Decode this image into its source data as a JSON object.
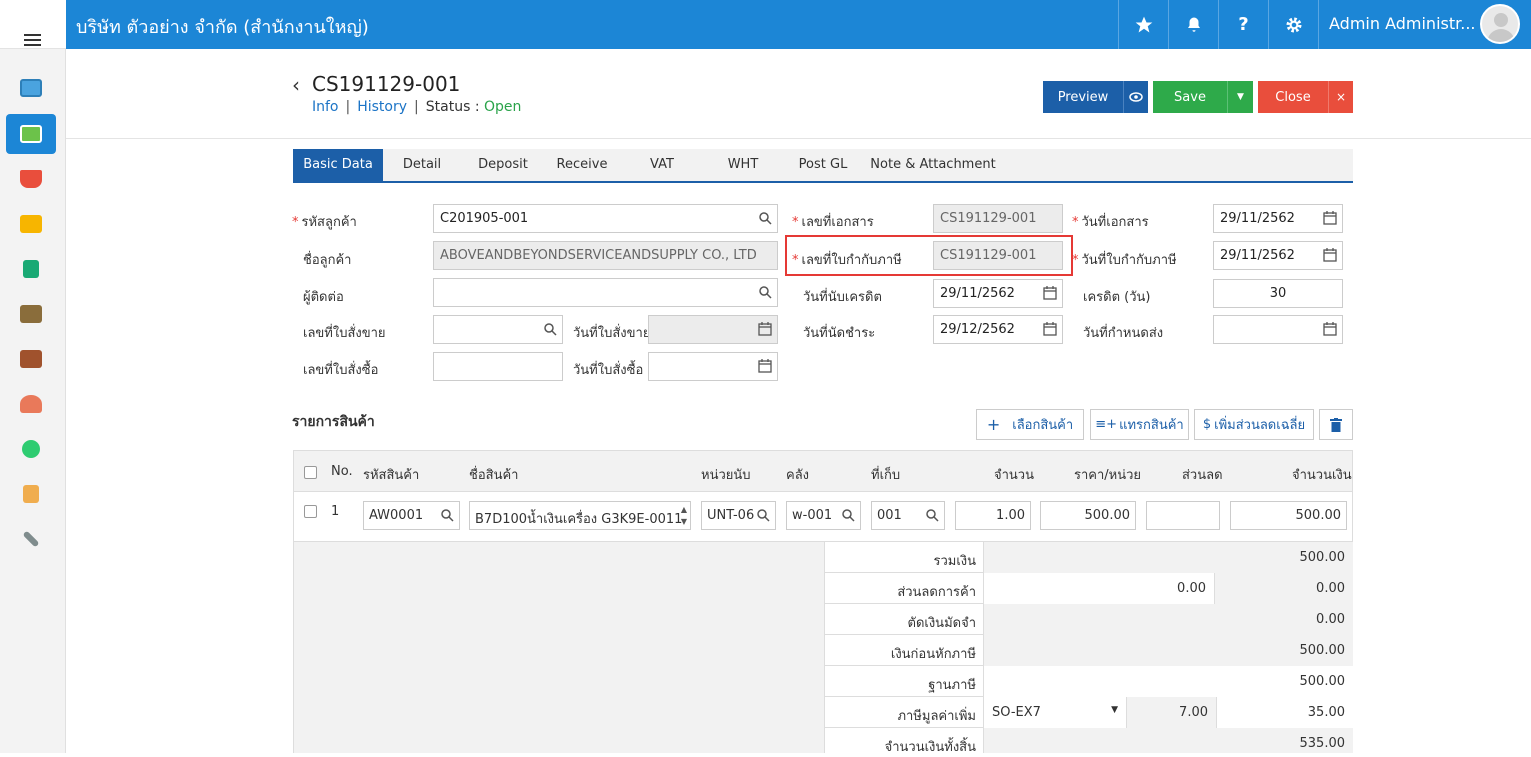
{
  "company": "บริษัท ตัวอย่าง จำกัด (สำนักงานใหญ่)",
  "user": "Admin Administr...",
  "topbar_icons": [
    "star-icon",
    "bell-icon",
    "help-icon",
    "gear-icon"
  ],
  "help_glyph": "?",
  "doc": {
    "number": "CS191129-001",
    "links": [
      "Info",
      "History"
    ],
    "status_label": "Status",
    "status_sep": ":",
    "status_value": "Open"
  },
  "actions": {
    "preview": "Preview",
    "save": "Save",
    "close": "Close"
  },
  "tabs": [
    "Basic Data",
    "Detail",
    "Deposit",
    "Receive",
    "VAT",
    "WHT",
    "Post GL",
    "Note & Attachment"
  ],
  "form": {
    "customer_code_label": "รหัสลูกค้า",
    "customer_code": "C201905-001",
    "customer_name_label": "ชื่อลูกค้า",
    "customer_name": "ABOVEANDBEYONDSERVICEANDSUPPLY CO., LTD",
    "contact_label": "ผู้ติดต่อ",
    "contact": "",
    "so_no_label": "เลขที่ใบสั่งขาย",
    "so_no": "",
    "so_date_label": "วันที่ใบสั่งขาย",
    "so_date": "",
    "po_no_label": "เลขที่ใบสั่งซื้อ",
    "po_no": "",
    "po_date_label": "วันที่ใบสั่งซื้อ",
    "po_date": "",
    "doc_no_label": "เลขที่เอกสาร",
    "doc_no": "CS191129-001",
    "tax_inv_no_label": "เลขที่ใบกำกับภาษี",
    "tax_inv_no": "CS191129-001",
    "credit_start_label": "วันที่นับเครดิต",
    "credit_start": "29/11/2562",
    "due_date_label": "วันที่นัดชำระ",
    "due_date": "29/12/2562",
    "doc_date_label": "วันที่เอกสาร",
    "doc_date": "29/11/2562",
    "tax_inv_date_label": "วันที่ใบกำกับภาษี",
    "tax_inv_date": "29/11/2562",
    "credit_days_label": "เครดิต (วัน)",
    "credit_days": "30",
    "delivery_date_label": "วันที่กำหนดส่ง",
    "delivery_date": ""
  },
  "items": {
    "title": "รายการสินค้า",
    "buttons": {
      "select": "เลือกสินค้า",
      "insert": "แทรกสินค้า",
      "discount": "เพิ่มส่วนลดเฉลี่ย"
    },
    "headers": [
      "No.",
      "รหัสสินค้า",
      "ชื่อสินค้า",
      "หน่วยนับ",
      "คลัง",
      "ที่เก็บ",
      "จำนวน",
      "ราคา/หน่วย",
      "ส่วนลด",
      "จำนวนเงิน"
    ],
    "rows": [
      {
        "no": "1",
        "code": "AW0001",
        "name": "B7D100น้ำเงินเครื่อง G3K9E-0011",
        "unit": "UNT-06",
        "warehouse": "w-001",
        "location": "001",
        "qty": "1.00",
        "price": "500.00",
        "discount": "",
        "amount": "500.00"
      }
    ]
  },
  "summary": {
    "total_label": "รวมเงิน",
    "total": "500.00",
    "discount_label": "ส่วนลดการค้า",
    "discount_input": "0.00",
    "discount": "0.00",
    "deposit_label": "ตัดเงินมัดจำ",
    "deposit": "0.00",
    "before_tax_label": "เงินก่อนหักภาษี",
    "before_tax": "500.00",
    "tax_base_label": "ฐานภาษี",
    "tax_base": "500.00",
    "vat_label": "ภาษีมูลค่าเพิ่ม",
    "vat_code": "SO-EX7",
    "vat_rate": "7.00",
    "vat": "35.00",
    "grand_total_label": "จำนวนเงินทั้งสิ้น",
    "grand_total": "535.00"
  }
}
